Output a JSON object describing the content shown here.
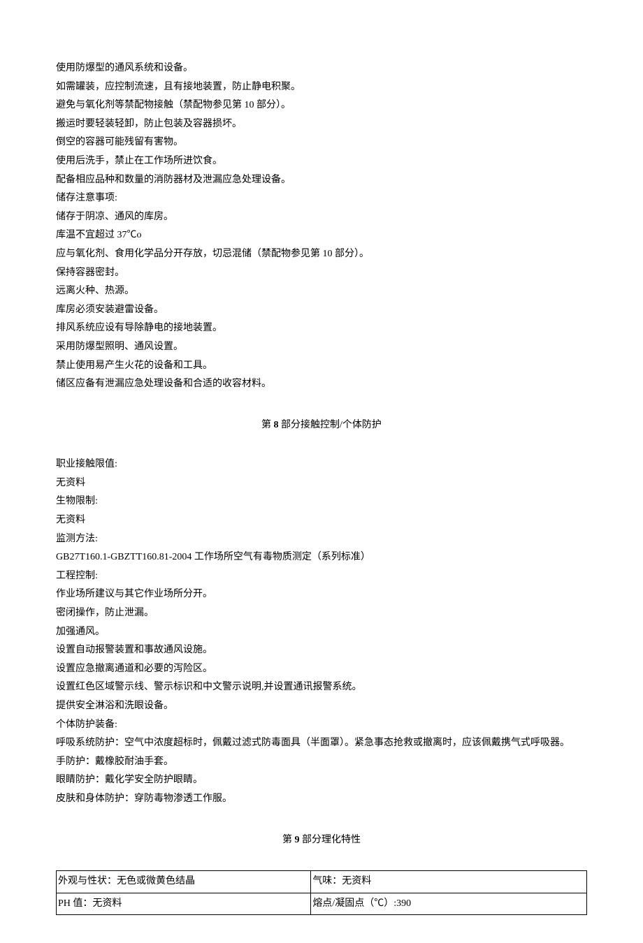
{
  "section7": {
    "lines": [
      "使用防爆型的通风系统和设备。",
      "如需罐装，应控制流速，且有接地装置，防止静电积聚。",
      "避免与氧化剂等禁配物接触（禁配物参见第 10 部分）。",
      "搬运时要轻装轻卸，防止包装及容器损坏。",
      "倒空的容器可能残留有害物。",
      "使用后洗手，禁止在工作场所进饮食。",
      "配备相应品种和数量的消防器材及泄漏应急处理设备。",
      "储存注意事项:",
      "储存于阴凉、通风的库房。",
      "库温不宜超过 37℃o",
      "应与氧化剂、食用化学品分开存放，切忌混储（禁配物参见第 10 部分）。",
      "保持容器密封。",
      "远离火种、热源。",
      "库房必须安装避雷设备。",
      "排风系统应设有导除静电的接地装置。",
      "采用防爆型照明、通风设置。",
      "禁止使用易产生火花的设备和工具。",
      "储区应备有泄漏应急处理设备和合适的收容材料。"
    ]
  },
  "section8": {
    "heading_prefix": "第 ",
    "heading_num": "8",
    "heading_suffix": " 部分接触控制/个体防护",
    "lines": [
      "职业接触限值:",
      "无资料",
      "生物限制:",
      "无资料",
      "监测方法:",
      "GB27T160.1-GBZTT160.81-2004 工作场所空气有毒物质测定（系列标准）",
      "工程控制:",
      "作业场所建议与其它作业场所分开。",
      "密闭操作，防止泄漏。",
      "加强通风。",
      "设置自动报警装置和事故通风设施。",
      "设置应急撤离通道和必要的泻险区。",
      "设置红色区域警示线、警示标识和中文警示说明,并设置通讯报警系统。",
      "提供安全淋浴和洗眼设备。",
      "个体防护装备:",
      "呼吸系统防护：空气中浓度超标时，佩戴过滤式防毒面具（半面罩）。紧急事态抢救或撤离时，应该佩戴携气式呼吸器。",
      "手防护：戴橡胶耐油手套。",
      "眼睛防护：戴化学安全防护眼睛。",
      "皮肤和身体防护：穿防毒物渗透工作服。"
    ]
  },
  "section9": {
    "heading_prefix": "第 ",
    "heading_num": "9",
    "heading_suffix": " 部分理化特性",
    "table": {
      "rows": [
        {
          "left": "外观与性状：无色或微黄色结晶",
          "right": "气味：无资料"
        },
        {
          "left": "PH 值：无资料",
          "right": "熔点/凝固点（℃）:390"
        }
      ]
    }
  }
}
